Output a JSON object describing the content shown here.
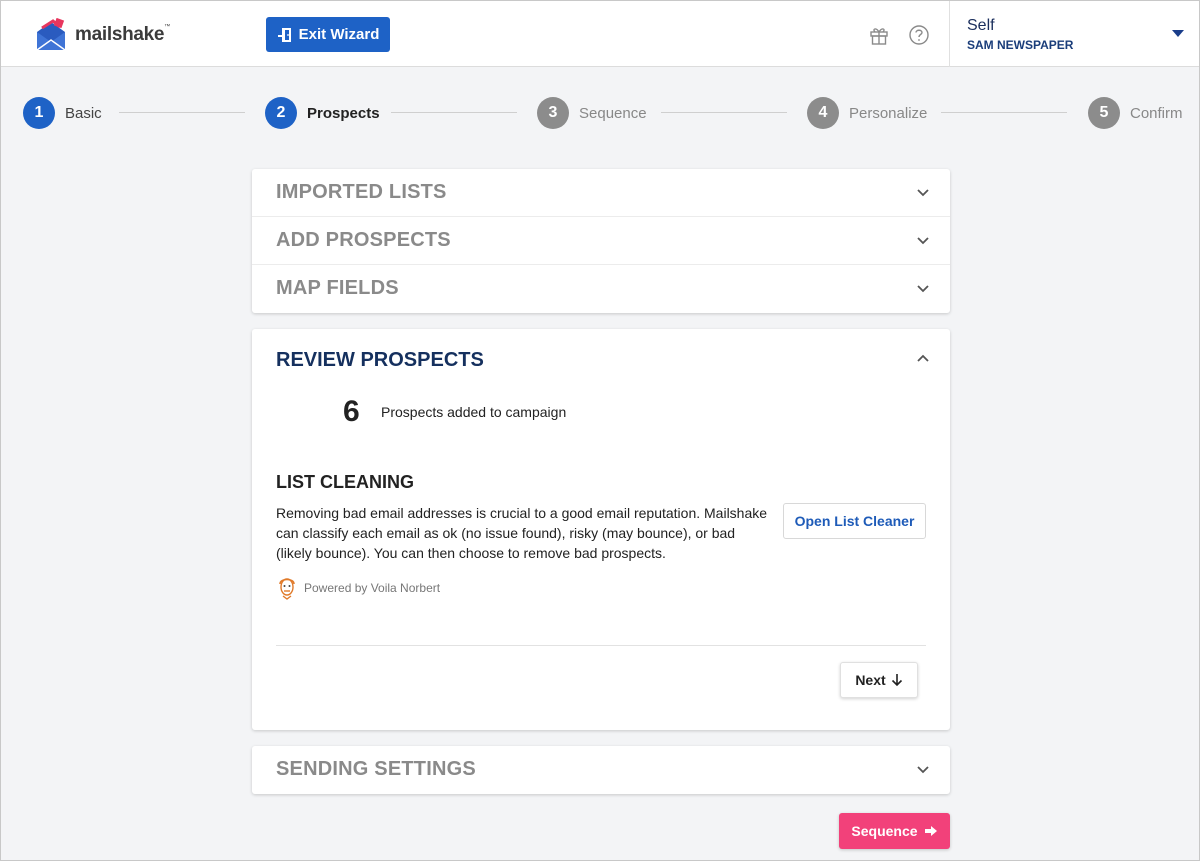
{
  "header": {
    "logo_text": "mailshake",
    "logo_tm": "™",
    "exit_label": "Exit Wizard",
    "account_name": "Self",
    "account_org": "SAM NEWSPAPER",
    "icons": [
      "gift-icon",
      "help-icon",
      "caret-down-icon"
    ]
  },
  "stepper": {
    "steps": [
      {
        "num": "1",
        "label": "Basic",
        "state": "done"
      },
      {
        "num": "2",
        "label": "Prospects",
        "state": "current"
      },
      {
        "num": "3",
        "label": "Sequence",
        "state": "upcoming"
      },
      {
        "num": "4",
        "label": "Personalize",
        "state": "upcoming"
      },
      {
        "num": "5",
        "label": "Confirm",
        "state": "upcoming"
      }
    ]
  },
  "sections": {
    "imported_lists": "IMPORTED LISTS",
    "add_prospects": "ADD PROSPECTS",
    "map_fields": "MAP FIELDS",
    "sending_settings": "SENDING SETTINGS"
  },
  "review": {
    "title": "REVIEW PROSPECTS",
    "count": "6",
    "count_label": "Prospects added to campaign",
    "list_cleaning_title": "LIST CLEANING",
    "list_cleaning_desc": "Removing bad email addresses is crucial to a good email reputation. Mailshake can classify each email as ok (no issue found), risky (may bounce), or bad (likely bounce). You can then choose to remove bad prospects.",
    "open_cleaner_label": "Open List Cleaner",
    "powered_by": "Powered by Voila Norbert",
    "next_label": "Next"
  },
  "footer": {
    "sequence_label": "Sequence"
  },
  "colors": {
    "primary": "#1e62c6",
    "accent": "#f2417a",
    "heading": "#15305e",
    "inactive": "#8c8c8c"
  }
}
